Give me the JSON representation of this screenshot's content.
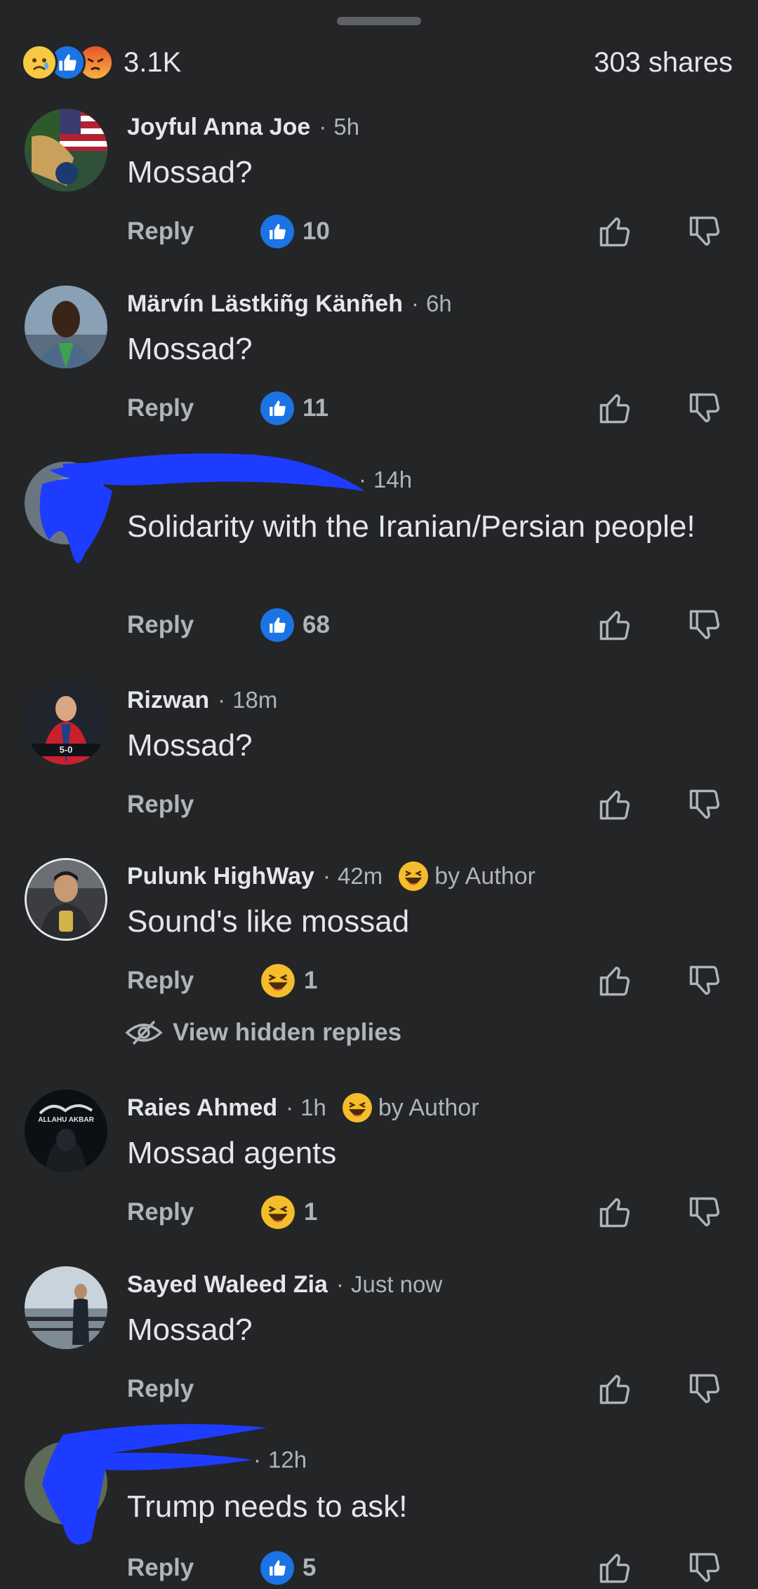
{
  "summary": {
    "reaction_count": "3.1K",
    "shares": "303 shares",
    "reaction_icons": [
      "sad-reaction-icon",
      "like-reaction-icon",
      "angry-reaction-icon"
    ]
  },
  "colors": {
    "background": "#242526",
    "like_blue": "#1b74e4",
    "text": "#e4e6eb",
    "muted": "#b0b3b8",
    "redaction": "#1d3cff"
  },
  "comments": [
    {
      "name": "Joyful Anna Joe",
      "time": "5h",
      "text": "Mossad?",
      "reply": "Reply",
      "reaction": "like",
      "reaction_count": "10",
      "author_badge": ""
    },
    {
      "name": "Märvín Lästkiñg Känñeh",
      "time": "6h",
      "text": "Mossad?",
      "reply": "Reply",
      "reaction": "like",
      "reaction_count": "11",
      "author_badge": ""
    },
    {
      "name": "",
      "time": "14h",
      "text": "Solidarity with the Iranian/Persian people!",
      "reply": "Reply",
      "reaction": "like",
      "reaction_count": "68",
      "author_badge": "",
      "redacted": true
    },
    {
      "name": "Rizwan",
      "time": "18m",
      "text": "Mossad?",
      "reply": "Reply",
      "reaction": "",
      "reaction_count": "",
      "author_badge": "",
      "avatar_caption": "5-0"
    },
    {
      "name": "Pulunk HighWay",
      "time": "42m",
      "text": "Sound's like mossad",
      "reply": "Reply",
      "reaction": "haha",
      "reaction_count": "1",
      "author_badge": "by Author"
    },
    {
      "name": "Raies Ahmed",
      "time": "1h",
      "text": "Mossad agents",
      "reply": "Reply",
      "reaction": "haha",
      "reaction_count": "1",
      "author_badge": "by Author",
      "avatar_caption": "ALLAHU AKBAR"
    },
    {
      "name": "Sayed Waleed Zia",
      "time": "Just now",
      "text": "Mossad?",
      "reply": "Reply",
      "reaction": "",
      "reaction_count": "",
      "author_badge": ""
    },
    {
      "name": "",
      "time": "12h",
      "text": "Trump needs to ask!",
      "reply": "Reply",
      "reaction": "like",
      "reaction_count": "5",
      "author_badge": "",
      "redacted": true
    }
  ],
  "hidden_replies": {
    "label": "View hidden replies"
  }
}
